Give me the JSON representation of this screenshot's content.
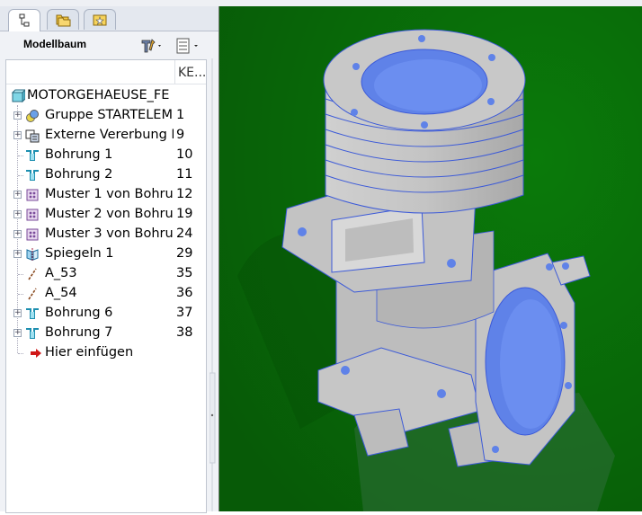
{
  "panel": {
    "title": "Modellbaum",
    "tabs": [
      {
        "icon": "model-tree-icon"
      },
      {
        "icon": "folder-browser-icon"
      },
      {
        "icon": "favorites-icon"
      }
    ],
    "tools": [
      "settings-icon",
      "show-options-icon"
    ],
    "column_header": "KE..."
  },
  "tree": {
    "root": "MOTORGEHAEUSE_FE",
    "items": [
      {
        "label": "Gruppe STARTELEM",
        "num": "1",
        "icon": "group-icon",
        "expandable": true
      },
      {
        "label": "Externe Vererbung I",
        "num": "9",
        "icon": "external-inheritance-icon",
        "expandable": true
      },
      {
        "label": "Bohrung 1",
        "num": "10",
        "icon": "hole-icon",
        "expandable": false
      },
      {
        "label": "Bohrung 2",
        "num": "11",
        "icon": "hole-icon",
        "expandable": false
      },
      {
        "label": "Muster 1 von Bohrun",
        "num": "12",
        "icon": "pattern-icon",
        "expandable": true
      },
      {
        "label": "Muster 2 von Bohrun",
        "num": "19",
        "icon": "pattern-icon",
        "expandable": true
      },
      {
        "label": "Muster 3 von Bohrun",
        "num": "24",
        "icon": "pattern-icon",
        "expandable": true
      },
      {
        "label": "Spiegeln 1",
        "num": "29",
        "icon": "mirror-icon",
        "expandable": true
      },
      {
        "label": "A_53",
        "num": "35",
        "icon": "datum-axis-icon",
        "expandable": false
      },
      {
        "label": "A_54",
        "num": "36",
        "icon": "datum-axis-icon",
        "expandable": false
      },
      {
        "label": "Bohrung 6",
        "num": "37",
        "icon": "hole-icon",
        "expandable": true
      },
      {
        "label": "Bohrung 7",
        "num": "38",
        "icon": "hole-icon",
        "expandable": true
      }
    ],
    "insert_here": "Hier einfügen"
  },
  "colors": {
    "viewport_bg": "#0a6a0a",
    "part_body": "#c9c9c9",
    "part_bore": "#5f82e8",
    "edge": "#3c5ad8"
  }
}
